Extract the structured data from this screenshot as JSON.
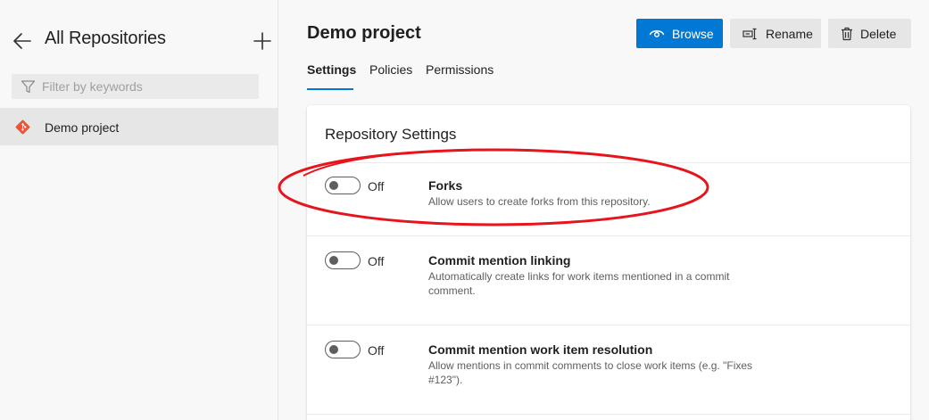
{
  "sidebar": {
    "title": "All Repositories",
    "filter_placeholder": "Filter by keywords",
    "repos": [
      {
        "label": "Demo project"
      }
    ]
  },
  "main": {
    "title": "Demo project",
    "buttons": {
      "browse": "Browse",
      "rename": "Rename",
      "delete": "Delete"
    },
    "tabs": [
      {
        "label": "Settings"
      },
      {
        "label": "Policies"
      },
      {
        "label": "Permissions"
      }
    ],
    "card": {
      "title": "Repository Settings",
      "settings": [
        {
          "state": "Off",
          "name": "Forks",
          "description": "Allow users to create forks from this repository."
        },
        {
          "state": "Off",
          "name": "Commit mention linking",
          "description": "Automatically create links for work items mentioned in a commit comment."
        },
        {
          "state": "Off",
          "name": "Commit mention work item resolution",
          "description": "Allow mentions in commit comments to close work items (e.g. \"Fixes #123\")."
        }
      ]
    }
  },
  "colors": {
    "accent": "#0078d4",
    "git_brand": "#f05033",
    "annotation": "#e8141c"
  },
  "icons": {
    "back": "arrow-left-icon",
    "add": "plus-icon",
    "filter": "funnel-icon",
    "repo": "git-icon",
    "browse": "eye-icon",
    "rename": "rename-icon",
    "delete": "trash-icon"
  }
}
